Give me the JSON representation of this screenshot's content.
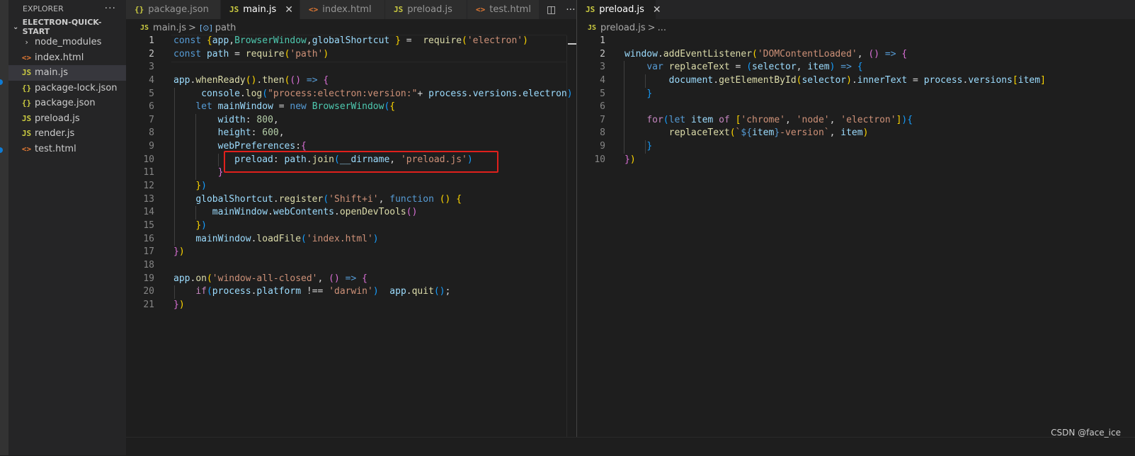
{
  "sidebar": {
    "header": "EXPLORER",
    "more": "···",
    "root": "ELECTRON-QUICK-START",
    "items": [
      {
        "icon": "›",
        "kind": "folder",
        "label": "node_modules"
      },
      {
        "icon": "<>",
        "kind": "html",
        "label": "index.html"
      },
      {
        "icon": "JS",
        "kind": "js",
        "label": "main.js"
      },
      {
        "icon": "{}",
        "kind": "json",
        "label": "package-lock.json"
      },
      {
        "icon": "{}",
        "kind": "json",
        "label": "package.json"
      },
      {
        "icon": "JS",
        "kind": "js",
        "label": "preload.js"
      },
      {
        "icon": "JS",
        "kind": "js",
        "label": "render.js"
      },
      {
        "icon": "<>",
        "kind": "html",
        "label": "test.html"
      }
    ]
  },
  "left_group": {
    "tabs": [
      {
        "icon": "{}",
        "label": "package.json"
      },
      {
        "icon": "JS",
        "label": "main.js",
        "close": "✕"
      },
      {
        "icon": "<>",
        "label": "index.html"
      },
      {
        "icon": "JS",
        "label": "preload.js"
      },
      {
        "icon": "<>",
        "label": "test.html"
      }
    ],
    "actions": {
      "split": "◫",
      "more": "···"
    },
    "breadcrumb": {
      "icon": "JS",
      "file": "main.js",
      "sep": ">",
      "symbol_icon": "[⊙]",
      "symbol": "path"
    }
  },
  "right_group": {
    "tab": {
      "icon": "JS",
      "label": "preload.js",
      "close": "✕"
    },
    "breadcrumb": {
      "icon": "JS",
      "file": "preload.js",
      "sep": ">",
      "rest": "..."
    }
  },
  "left_code": {
    "line_numbers": [
      "1",
      "2",
      "3",
      "4",
      "5",
      "6",
      "7",
      "8",
      "9",
      "10",
      "11",
      "12",
      "13",
      "14",
      "15",
      "16",
      "17",
      "18",
      "19",
      "20",
      "21"
    ],
    "lines": [
      [
        [
          "kw",
          "const "
        ],
        [
          "b1",
          "{"
        ],
        [
          "var",
          "app"
        ],
        [
          "",
          ","
        ],
        [
          "cls",
          "BrowserWindow"
        ],
        [
          "",
          ","
        ],
        [
          "var",
          "globalShortcut"
        ],
        [
          "",
          " "
        ],
        [
          "b1",
          "}"
        ],
        [
          "",
          " =  "
        ],
        [
          "fn",
          "require"
        ],
        [
          "b1",
          "("
        ],
        [
          "str",
          "'electron'"
        ],
        [
          "b1",
          ")"
        ]
      ],
      [
        [
          "kw",
          "const "
        ],
        [
          "var",
          "path"
        ],
        [
          "",
          " = "
        ],
        [
          "fn",
          "require"
        ],
        [
          "b1",
          "("
        ],
        [
          "str",
          "'path'"
        ],
        [
          "b1",
          ")"
        ]
      ],
      [],
      [
        [
          "var",
          "app"
        ],
        [
          "",
          "."
        ],
        [
          "fn",
          "whenReady"
        ],
        [
          "b1",
          "()"
        ],
        [
          "",
          "."
        ],
        [
          "fn",
          "then"
        ],
        [
          "b1",
          "("
        ],
        [
          "b2",
          "()"
        ],
        [
          "",
          " "
        ],
        [
          "kw",
          "=>"
        ],
        [
          "",
          " "
        ],
        [
          "b2",
          "{"
        ]
      ],
      [
        [
          "",
          "     "
        ],
        [
          "var",
          "console"
        ],
        [
          "",
          "."
        ],
        [
          "fn",
          "log"
        ],
        [
          "b3",
          "("
        ],
        [
          "str",
          "\"process:electron:version:\""
        ],
        [
          "",
          "+ "
        ],
        [
          "var",
          "process"
        ],
        [
          "",
          "."
        ],
        [
          "var",
          "versions"
        ],
        [
          "",
          "."
        ],
        [
          "var",
          "electron"
        ],
        [
          "b3",
          ")"
        ]
      ],
      [
        [
          "",
          "    "
        ],
        [
          "kw",
          "let "
        ],
        [
          "var",
          "mainWindow"
        ],
        [
          "",
          " = "
        ],
        [
          "kw",
          "new "
        ],
        [
          "cls",
          "BrowserWindow"
        ],
        [
          "b3",
          "("
        ],
        [
          "b1",
          "{"
        ]
      ],
      [
        [
          "",
          "        "
        ],
        [
          "var",
          "width"
        ],
        [
          "",
          ": "
        ],
        [
          "num",
          "800"
        ],
        [
          "",
          ","
        ]
      ],
      [
        [
          "",
          "        "
        ],
        [
          "var",
          "height"
        ],
        [
          "",
          ": "
        ],
        [
          "num",
          "600"
        ],
        [
          "",
          ","
        ]
      ],
      [
        [
          "",
          "        "
        ],
        [
          "var",
          "webPreferences"
        ],
        [
          "",
          ":"
        ],
        [
          "b2",
          "{"
        ]
      ],
      [
        [
          "",
          "           "
        ],
        [
          "var",
          "preload"
        ],
        [
          "",
          ": "
        ],
        [
          "var",
          "path"
        ],
        [
          "",
          "."
        ],
        [
          "fn",
          "join"
        ],
        [
          "b3",
          "("
        ],
        [
          "var",
          "__dirname"
        ],
        [
          "",
          ", "
        ],
        [
          "str",
          "'preload.js'"
        ],
        [
          "b3",
          ")"
        ]
      ],
      [
        [
          "",
          "        "
        ],
        [
          "b2",
          "}"
        ]
      ],
      [
        [
          "",
          "    "
        ],
        [
          "b1",
          "}"
        ],
        [
          "b3",
          ")"
        ]
      ],
      [
        [
          "",
          "    "
        ],
        [
          "var",
          "globalShortcut"
        ],
        [
          "",
          "."
        ],
        [
          "fn",
          "register"
        ],
        [
          "b3",
          "("
        ],
        [
          "str",
          "'Shift+i'"
        ],
        [
          "",
          ", "
        ],
        [
          "kw",
          "function"
        ],
        [
          "",
          " "
        ],
        [
          "b1",
          "()"
        ],
        [
          "",
          " "
        ],
        [
          "b1",
          "{"
        ]
      ],
      [
        [
          "",
          "       "
        ],
        [
          "var",
          "mainWindow"
        ],
        [
          "",
          "."
        ],
        [
          "var",
          "webContents"
        ],
        [
          "",
          "."
        ],
        [
          "fn",
          "openDevTools"
        ],
        [
          "b2",
          "()"
        ]
      ],
      [
        [
          "",
          "    "
        ],
        [
          "b1",
          "}"
        ],
        [
          "b3",
          ")"
        ]
      ],
      [
        [
          "",
          "    "
        ],
        [
          "var",
          "mainWindow"
        ],
        [
          "",
          "."
        ],
        [
          "fn",
          "loadFile"
        ],
        [
          "b3",
          "("
        ],
        [
          "str",
          "'index.html'"
        ],
        [
          "b3",
          ")"
        ]
      ],
      [
        [
          "b2",
          "}"
        ],
        [
          "b1",
          ")"
        ]
      ],
      [],
      [
        [
          "var",
          "app"
        ],
        [
          "",
          "."
        ],
        [
          "fn",
          "on"
        ],
        [
          "b1",
          "("
        ],
        [
          "str",
          "'window-all-closed'"
        ],
        [
          "",
          ", "
        ],
        [
          "b2",
          "()"
        ],
        [
          "",
          " "
        ],
        [
          "kw",
          "=>"
        ],
        [
          "",
          " "
        ],
        [
          "b2",
          "{"
        ]
      ],
      [
        [
          "",
          "    "
        ],
        [
          "ctl",
          "if"
        ],
        [
          "b3",
          "("
        ],
        [
          "var",
          "process"
        ],
        [
          "",
          "."
        ],
        [
          "var",
          "platform"
        ],
        [
          "",
          " !== "
        ],
        [
          "str",
          "'darwin'"
        ],
        [
          "b3",
          ")"
        ],
        [
          "",
          "  "
        ],
        [
          "var",
          "app"
        ],
        [
          "",
          "."
        ],
        [
          "fn",
          "quit"
        ],
        [
          "b3",
          "()"
        ],
        [
          "",
          ";"
        ]
      ],
      [
        [
          "b2",
          "}"
        ],
        [
          "b1",
          ")"
        ]
      ]
    ]
  },
  "right_code": {
    "line_numbers": [
      "1",
      "2",
      "3",
      "4",
      "5",
      "6",
      "7",
      "8",
      "9",
      "10"
    ],
    "lines": [
      [],
      [
        [
          "var",
          "window"
        ],
        [
          "",
          "."
        ],
        [
          "fn",
          "addEventListener"
        ],
        [
          "b1",
          "("
        ],
        [
          "str",
          "'DOMContentLoaded'"
        ],
        [
          "",
          ", "
        ],
        [
          "b2",
          "()"
        ],
        [
          "",
          " "
        ],
        [
          "kw",
          "=>"
        ],
        [
          "",
          " "
        ],
        [
          "b2",
          "{"
        ]
      ],
      [
        [
          "",
          "    "
        ],
        [
          "kw",
          "var "
        ],
        [
          "fn",
          "replaceText"
        ],
        [
          "",
          " = "
        ],
        [
          "b3",
          "("
        ],
        [
          "var",
          "selector"
        ],
        [
          "",
          ", "
        ],
        [
          "var",
          "item"
        ],
        [
          "b3",
          ")"
        ],
        [
          "",
          " "
        ],
        [
          "kw",
          "=>"
        ],
        [
          "",
          " "
        ],
        [
          "b3",
          "{"
        ]
      ],
      [
        [
          "",
          "        "
        ],
        [
          "var",
          "document"
        ],
        [
          "",
          "."
        ],
        [
          "fn",
          "getElementById"
        ],
        [
          "b1",
          "("
        ],
        [
          "var",
          "selector"
        ],
        [
          "b1",
          ")"
        ],
        [
          "",
          "."
        ],
        [
          "var",
          "innerText"
        ],
        [
          "",
          " = "
        ],
        [
          "var",
          "process"
        ],
        [
          "",
          "."
        ],
        [
          "var",
          "versions"
        ],
        [
          "b1",
          "["
        ],
        [
          "var",
          "item"
        ],
        [
          "b1",
          "]"
        ]
      ],
      [
        [
          "",
          "    "
        ],
        [
          "b3",
          "}"
        ]
      ],
      [],
      [
        [
          "",
          "    "
        ],
        [
          "ctl",
          "for"
        ],
        [
          "b3",
          "("
        ],
        [
          "kw",
          "let "
        ],
        [
          "var",
          "item"
        ],
        [
          "",
          " "
        ],
        [
          "ctl",
          "of"
        ],
        [
          "",
          " "
        ],
        [
          "b1",
          "["
        ],
        [
          "str",
          "'chrome'"
        ],
        [
          "",
          ", "
        ],
        [
          "str",
          "'node'"
        ],
        [
          "",
          ", "
        ],
        [
          "str",
          "'electron'"
        ],
        [
          "b1",
          "]"
        ],
        [
          "b3",
          ")"
        ],
        [
          "b3",
          "{"
        ]
      ],
      [
        [
          "",
          "        "
        ],
        [
          "fn",
          "replaceText"
        ],
        [
          "b1",
          "("
        ],
        [
          "str",
          "`"
        ],
        [
          "kw",
          "${"
        ],
        [
          "var",
          "item"
        ],
        [
          "kw",
          "}"
        ],
        [
          "str",
          "-version`"
        ],
        [
          "",
          ", "
        ],
        [
          "var",
          "item"
        ],
        [
          "b1",
          ")"
        ]
      ],
      [
        [
          "",
          "    "
        ],
        [
          "b3",
          "}"
        ]
      ],
      [
        [
          "b2",
          "}"
        ],
        [
          "b1",
          ")"
        ]
      ]
    ]
  },
  "watermark": "CSDN @face_ice"
}
